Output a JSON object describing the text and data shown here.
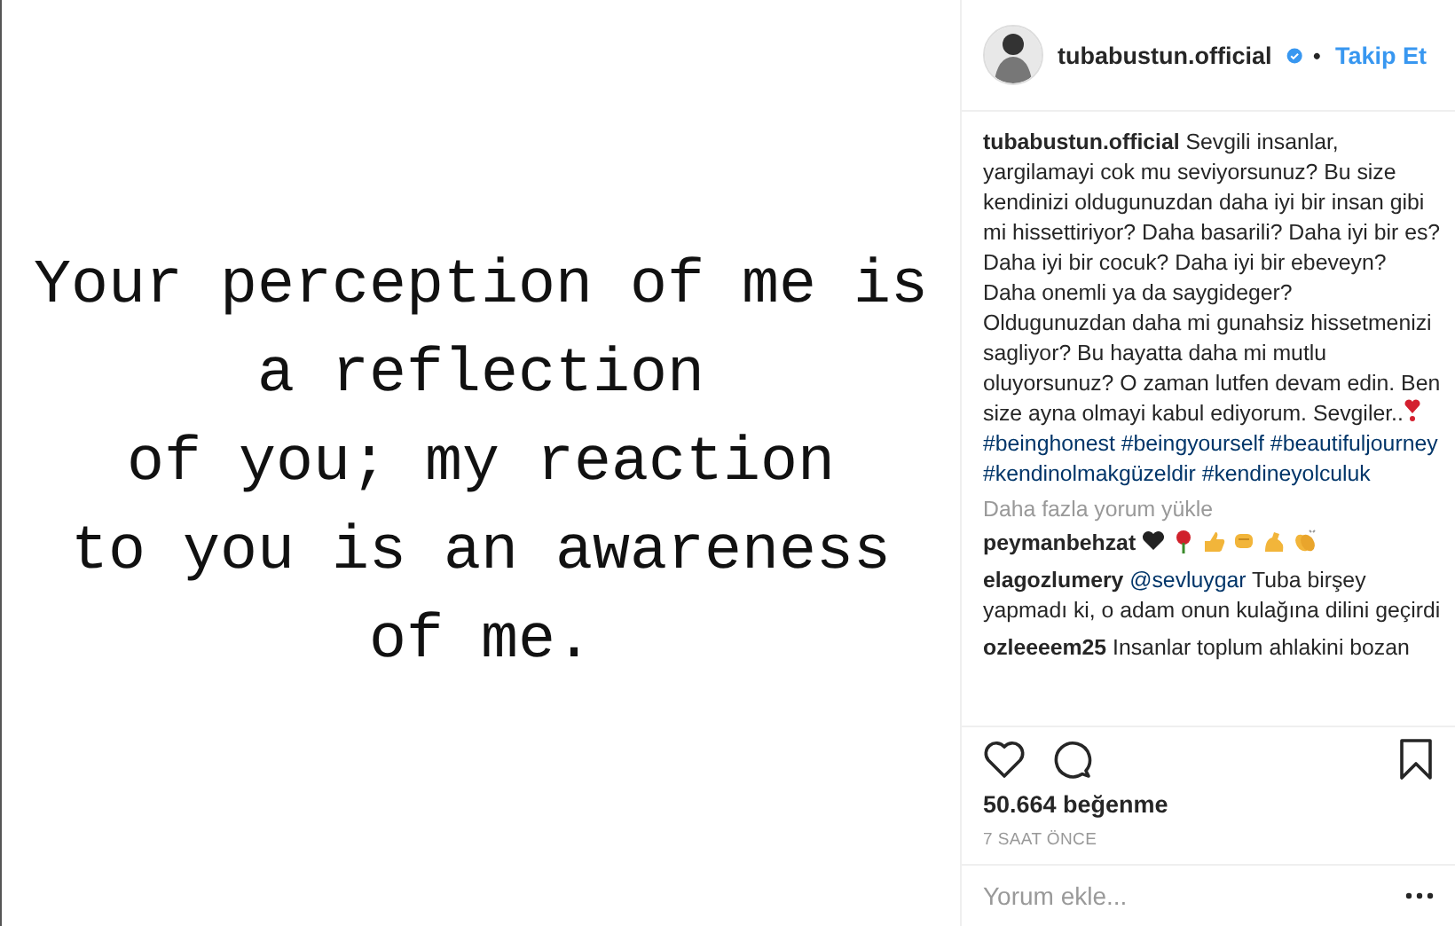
{
  "post_image": {
    "lines": [
      "Your perception of me is",
      "a reflection",
      "of you; my reaction",
      "to you is an awareness",
      "of me."
    ]
  },
  "header": {
    "username": "tubabustun.official",
    "verified": true,
    "separator": "•",
    "follow": "Takip Et"
  },
  "caption": {
    "username": "tubabustun.official",
    "text": "Sevgili insanlar, yargilamayi cok mu seviyorsunuz? Bu size kendinizi oldugunuzdan daha iyi bir insan gibi mi hissettiriyor? Daha basarili? Daha iyi bir es? Daha iyi bir cocuk? Daha iyi bir ebeveyn? Daha onemli ya da saygideger? Oldugunuzdan daha mi gunahsiz hissetmenizi sagliyor? Bu hayatta daha mi mutlu oluyorsunuz? O zaman lutfen devam edin. Ben size ayna olmayi kabul ediyorum. Sevgiler..",
    "hashtags": [
      "#beinghonest",
      "#beingyourself",
      "#beautifuljourney",
      "#kendinolmakgüzeldir",
      "#kendineyolculuk"
    ]
  },
  "load_more": "Daha fazla yorum yükle",
  "comments": [
    {
      "kind": "emoji",
      "username": "peymanbehzat"
    },
    {
      "kind": "text",
      "username": "elagozlumery",
      "mention": "@sevluygar",
      "text": "Tuba birşey yapmadı ki, o adam onun kulağına dilini geçirdi"
    },
    {
      "kind": "text",
      "username": "ozleeeem25",
      "text": "Insanlar toplum ahlakini bozan"
    }
  ],
  "likes": "50.664 beğenme",
  "time": "7 SAAT ÖNCE",
  "comment_field": {
    "placeholder": "Yorum ekle..."
  }
}
